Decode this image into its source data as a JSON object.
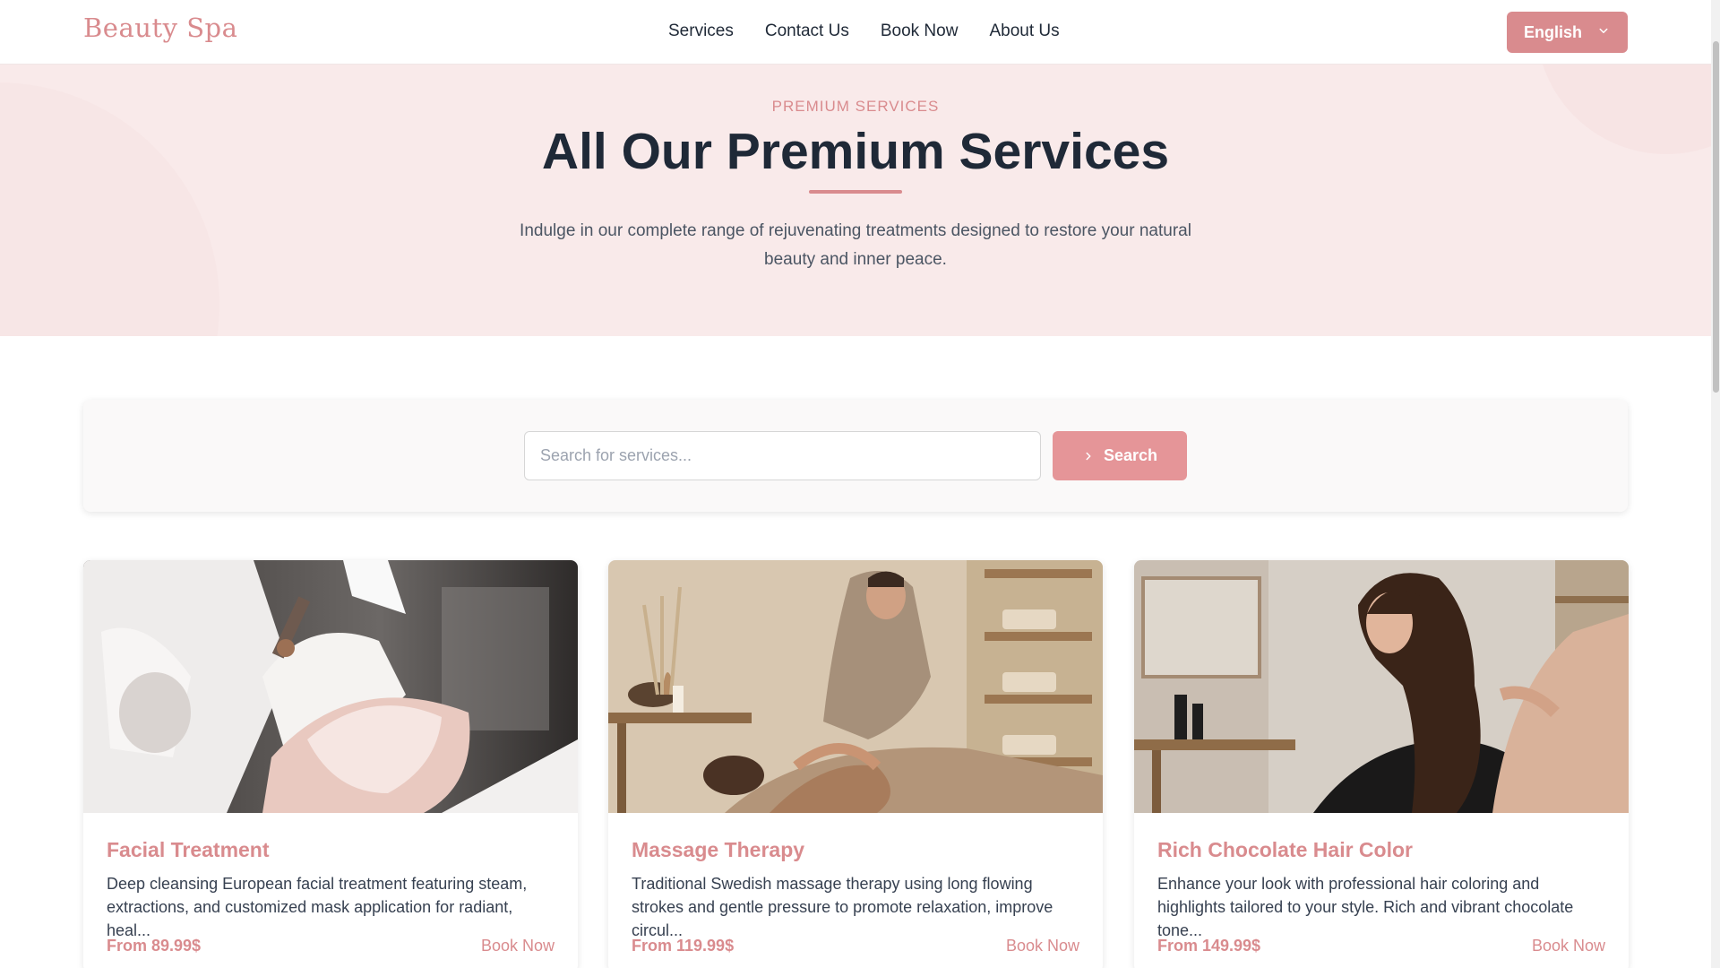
{
  "header": {
    "logo": "Beauty Spa",
    "nav": [
      "Services",
      "Contact Us",
      "Book Now",
      "About Us"
    ],
    "language": "English"
  },
  "hero": {
    "eyebrow": "PREMIUM SERVICES",
    "title": "All Our Premium Services",
    "subtitle": "Indulge in our complete range of rejuvenating treatments designed to restore your natural beauty and inner peace."
  },
  "search": {
    "placeholder": "Search for services...",
    "button_label": "Search"
  },
  "cards": [
    {
      "title": "Facial Treatment",
      "description": "Deep cleansing European facial treatment featuring steam, extractions, and customized mask application for radiant, heal...",
      "price": "From 89.99$",
      "cta": "Book Now"
    },
    {
      "title": "Massage Therapy",
      "description": "Traditional Swedish massage therapy using long flowing strokes and gentle pressure to promote relaxation, improve circul...",
      "price": "From 119.99$",
      "cta": "Book Now"
    },
    {
      "title": "Rich Chocolate Hair Color",
      "description": "Enhance your look with professional hair coloring and highlights tailored to your style. Rich and vibrant chocolate tone...",
      "price": "From 149.99$",
      "cta": "Book Now"
    }
  ],
  "colors": {
    "accent": "#d98b8e",
    "hero_bg": "#f9eaea",
    "text": "#1f2937"
  }
}
